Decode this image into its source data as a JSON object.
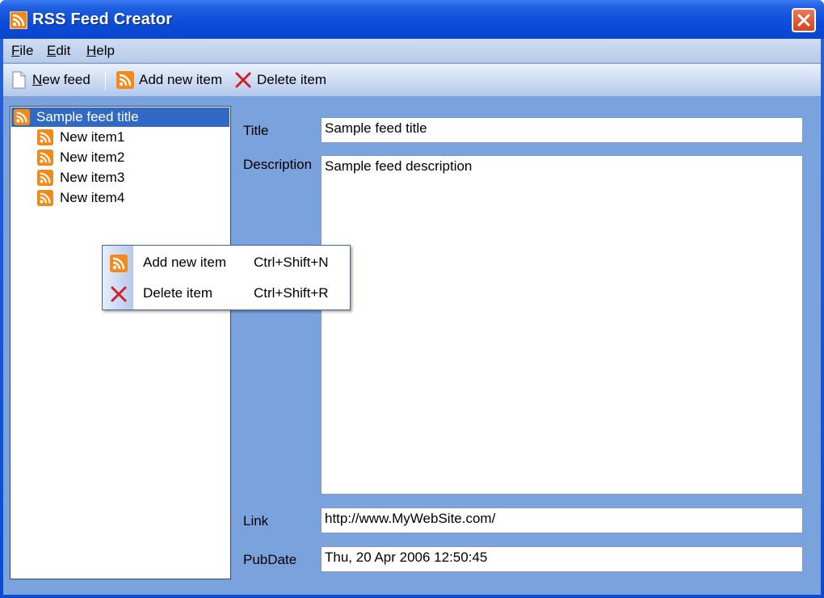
{
  "window": {
    "title": "RSS Feed Creator"
  },
  "menu": [
    {
      "underline": "F",
      "rest": "ile"
    },
    {
      "underline": "E",
      "rest": "dit"
    },
    {
      "underline": "H",
      "rest": "elp"
    }
  ],
  "toolbar": {
    "new_feed": {
      "underline": "N",
      "rest": "ew feed"
    },
    "add_new_item": "Add new item",
    "delete_item": "Delete item"
  },
  "tree": {
    "root": "Sample feed title",
    "items": [
      "New item1",
      "New item2",
      "New item3",
      "New item4"
    ]
  },
  "form": {
    "title_label": "Title",
    "title_value": "Sample feed title",
    "description_label": "Description",
    "description_value": "Sample feed description",
    "link_label": "Link",
    "link_value": "http://www.MyWebSite.com/",
    "pubdate_label": "PubDate",
    "pubdate_value": "Thu, 20 Apr 2006 12:50:45"
  },
  "context_menu": {
    "items": [
      {
        "label": "Add new item",
        "shortcut": "Ctrl+Shift+N",
        "icon": "rss-icon"
      },
      {
        "label": "Delete item",
        "shortcut": "Ctrl+Shift+R",
        "icon": "delete-x-icon"
      }
    ]
  },
  "colors": {
    "rss_orange": "#f08a1c",
    "delete_red": "#d0202a",
    "selection": "#316ac5"
  }
}
